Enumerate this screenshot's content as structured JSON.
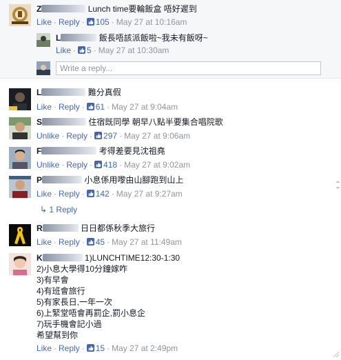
{
  "c1": {
    "name_initial": "Z",
    "text": "Lunch time要輪飯盒 唔好遲到",
    "like": "Like",
    "reply": "Reply",
    "likes": "105",
    "date": "May 27 at 10:16am"
  },
  "r1": {
    "name_initial": "L",
    "text": "飯長唔該派飯啦~我未有飯呀~",
    "like": "Like",
    "likes": "5",
    "date": "May 27 at 10:30am"
  },
  "write_reply": {
    "placeholder": "Write a reply..."
  },
  "c2": {
    "name_initial": "L",
    "text": "難分真假",
    "like": "Like",
    "reply": "Reply",
    "likes": "61",
    "date": "May 27 at 9:04am"
  },
  "c3": {
    "name_initial": "S",
    "text": "住宿既同學 朝早八點半要集合唱院歌",
    "like": "Unlike",
    "reply": "Reply",
    "likes": "297",
    "date": "May 27 at 9:06am"
  },
  "c4": {
    "name_initial": "F",
    "text": "考得差要見沈祖堯",
    "like": "Unlike",
    "reply": "Reply",
    "likes": "418",
    "date": "May 27 at 9:02am"
  },
  "c5": {
    "name_initial": "P",
    "text": "小息係用嚟由山腳跑到山上",
    "like": "Like",
    "reply": "Reply",
    "likes": "142",
    "date": "May 27 at 9:27am"
  },
  "c5_replies": "1 Reply",
  "c6": {
    "name_initial": "R",
    "text": "日日都係秋季大旅行",
    "like": "Like",
    "reply": "Reply",
    "likes": "45",
    "date": "May 27 at 11:49am"
  },
  "c7": {
    "name_initial": "K",
    "lines": [
      "1)LUNCHTIME12:30-1:30",
      "2)小息大學得10分鐘嫁咋",
      "3)有早會",
      "4)有班會旅行",
      "5)有家長日,一年一次",
      "6)上緊堂唔會再罰企,罰小息企",
      "7)玩手機會記小過",
      "希望幫到你"
    ],
    "like": "Like",
    "reply": "Reply",
    "likes": "15",
    "date": "May 27 at 2:49pm"
  },
  "colors": {
    "link": "#4267b2",
    "meta": "#90949c",
    "thread_bg": "#f6f7f9"
  }
}
